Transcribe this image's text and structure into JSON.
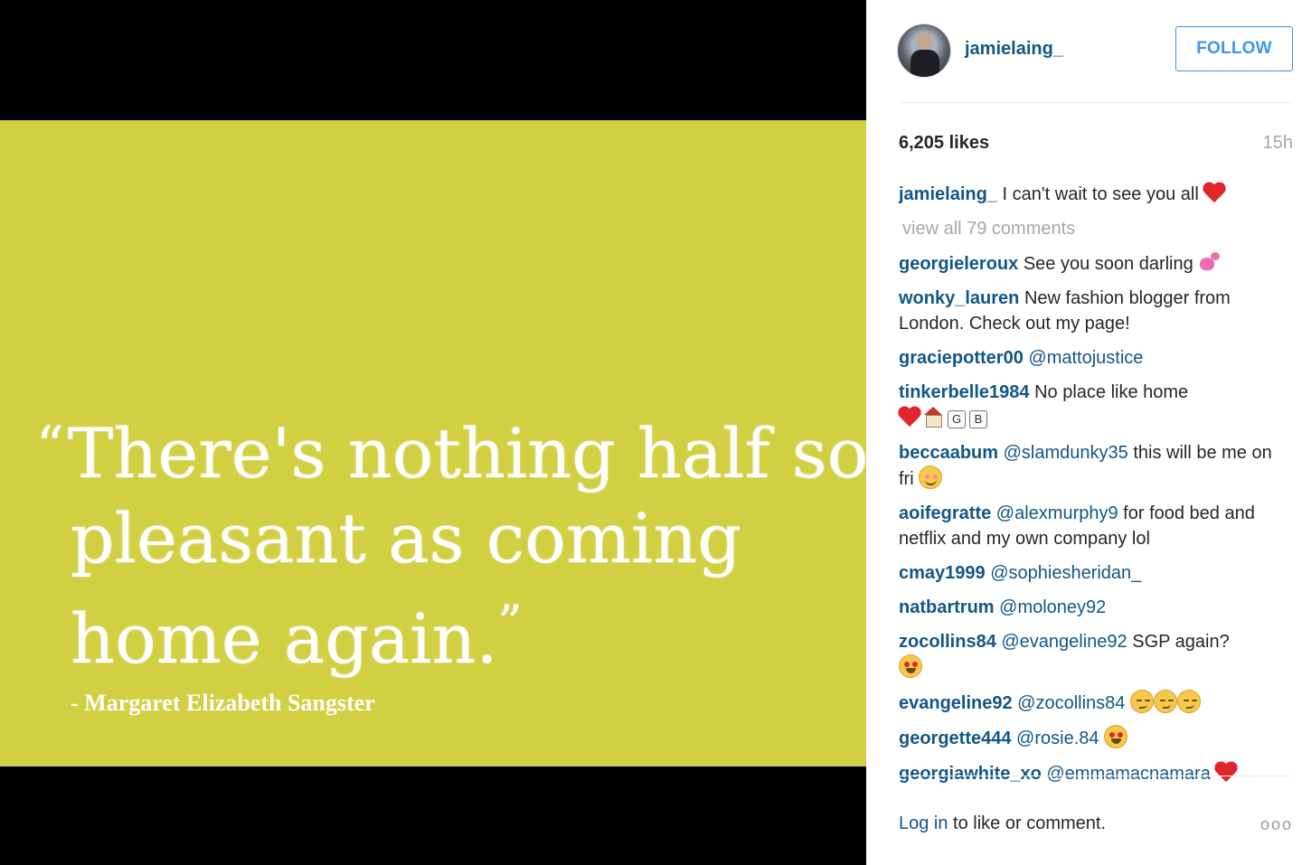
{
  "media": {
    "quote_lines": [
      "There's nothing half so",
      "pleasant as coming",
      "home again."
    ],
    "open_quote": "“",
    "close_quote": "”",
    "author": "- Margaret Elizabeth Sangster",
    "card_color": "#d3cf43"
  },
  "header": {
    "username": "jamielaing_",
    "follow_label": "FOLLOW"
  },
  "stats": {
    "likes": "6,205 likes",
    "time": "15h"
  },
  "caption": {
    "user": "jamielaing_",
    "text": " I can't wait to see you all "
  },
  "view_all": "view all 79 comments",
  "comments": [
    {
      "user": "georgieleroux",
      "mention": "",
      "text": " See you soon darling "
    },
    {
      "user": "wonky_lauren",
      "mention": "",
      "text": " New fashion blogger from London. Check out my page!"
    },
    {
      "user": "graciepotter00",
      "mention": " @mattojustice",
      "text": ""
    },
    {
      "user": "tinkerbelle1984",
      "mention": "",
      "text": " No place like home"
    },
    {
      "user": "beccaabum",
      "mention": " @slamdunky35",
      "text": " this will be me on fri "
    },
    {
      "user": "aoifegratte",
      "mention": " @alexmurphy9",
      "text": " for food bed and netflix and my own company lol"
    },
    {
      "user": "cmay1999",
      "mention": " @sophiesheridan_",
      "text": ""
    },
    {
      "user": "natbartrum",
      "mention": " @moloney92",
      "text": ""
    },
    {
      "user": "zocollins84",
      "mention": " @evangeline92",
      "text": " SGP again?"
    },
    {
      "user": "evangeline92",
      "mention": " @zocollins84",
      "text": " "
    },
    {
      "user": "georgette444",
      "mention": " @rosie.84",
      "text": " "
    },
    {
      "user": "georgiawhite_xo",
      "mention": " @emmamacnamara",
      "text": " "
    }
  ],
  "tinker_boxes": [
    "G",
    "B"
  ],
  "footer": {
    "login": "Log in",
    "rest": " to like or comment.",
    "more": "ooo"
  },
  "icons": {
    "heart": "red-heart-icon",
    "two_hearts": "two-hearts-icon",
    "house": "house-icon",
    "blush": "smiling-face-icon",
    "heart_eyes": "heart-eyes-face-icon",
    "smirk": "smirking-face-icon"
  }
}
